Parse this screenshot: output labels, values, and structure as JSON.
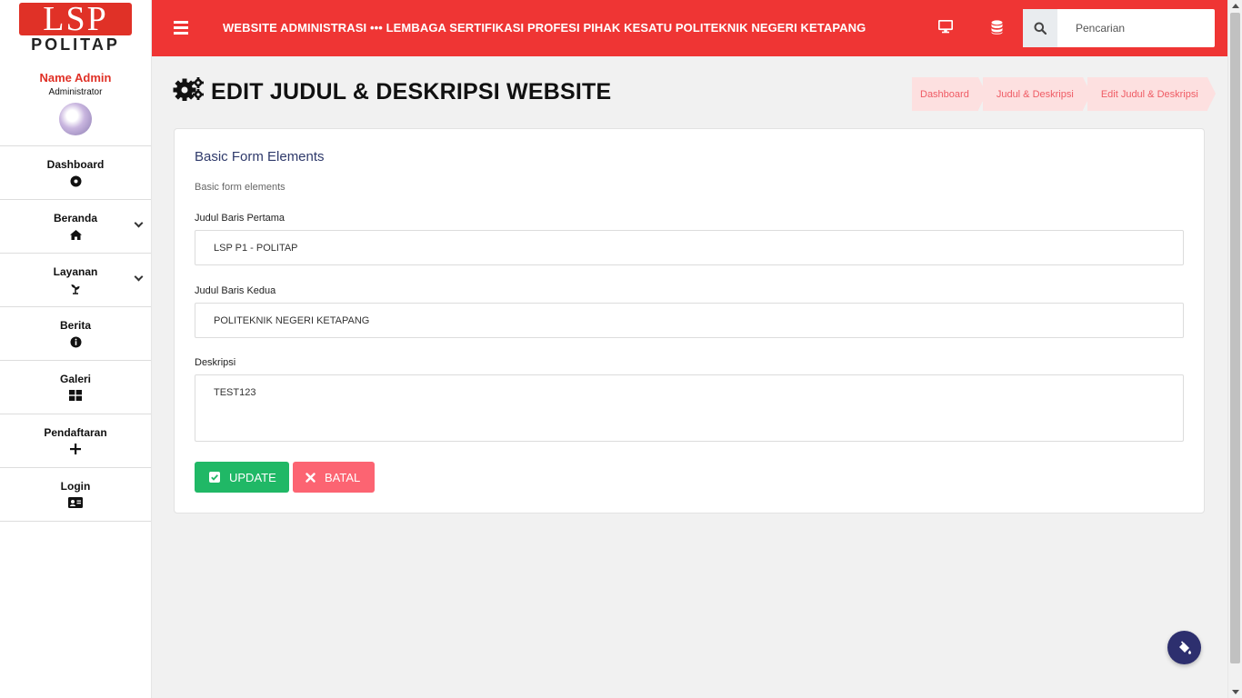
{
  "brand": {
    "logo_top": "LSP",
    "logo_bottom": "POLITAP"
  },
  "user": {
    "name": "Name Admin",
    "role": "Administrator"
  },
  "sidebar": {
    "items": [
      {
        "label": "Dashboard",
        "icon": "dashboard-icon"
      },
      {
        "label": "Beranda",
        "icon": "home-icon",
        "has_submenu": true
      },
      {
        "label": "Layanan",
        "icon": "seedling-icon",
        "has_submenu": true
      },
      {
        "label": "Berita",
        "icon": "info-icon"
      },
      {
        "label": "Galeri",
        "icon": "grid-icon"
      },
      {
        "label": "Pendaftaran",
        "icon": "plus-icon"
      },
      {
        "label": "Login",
        "icon": "id-card-icon"
      }
    ]
  },
  "topbar": {
    "title": "WEBSITE ADMINISTRASI ••• LEMBAGA SERTIFIKASI PROFESI PIHAK KESATU POLITEKNIK NEGERI KETAPANG",
    "search_placeholder": "Pencarian",
    "color": "#ef3534"
  },
  "page": {
    "title": "EDIT JUDUL & DESKRIPSI WEBSITE",
    "breadcrumb": [
      "Dashboard",
      "Judul & Deskripsi",
      "Edit Judul & Deskripsi"
    ]
  },
  "form": {
    "title": "Basic Form Elements",
    "subtitle": "Basic form elements",
    "fields": [
      {
        "label": "Judul Baris Pertama",
        "value": "LSP P1 - POLITAP"
      },
      {
        "label": "Judul Baris Kedua",
        "value": "POLITEKNIK NEGERI KETAPANG"
      },
      {
        "label": "Deskripsi",
        "value": "TEST123"
      }
    ],
    "update_label": "UPDATE",
    "cancel_label": "BATAL",
    "update_color": "#20b866",
    "cancel_color": "#fc6472"
  }
}
